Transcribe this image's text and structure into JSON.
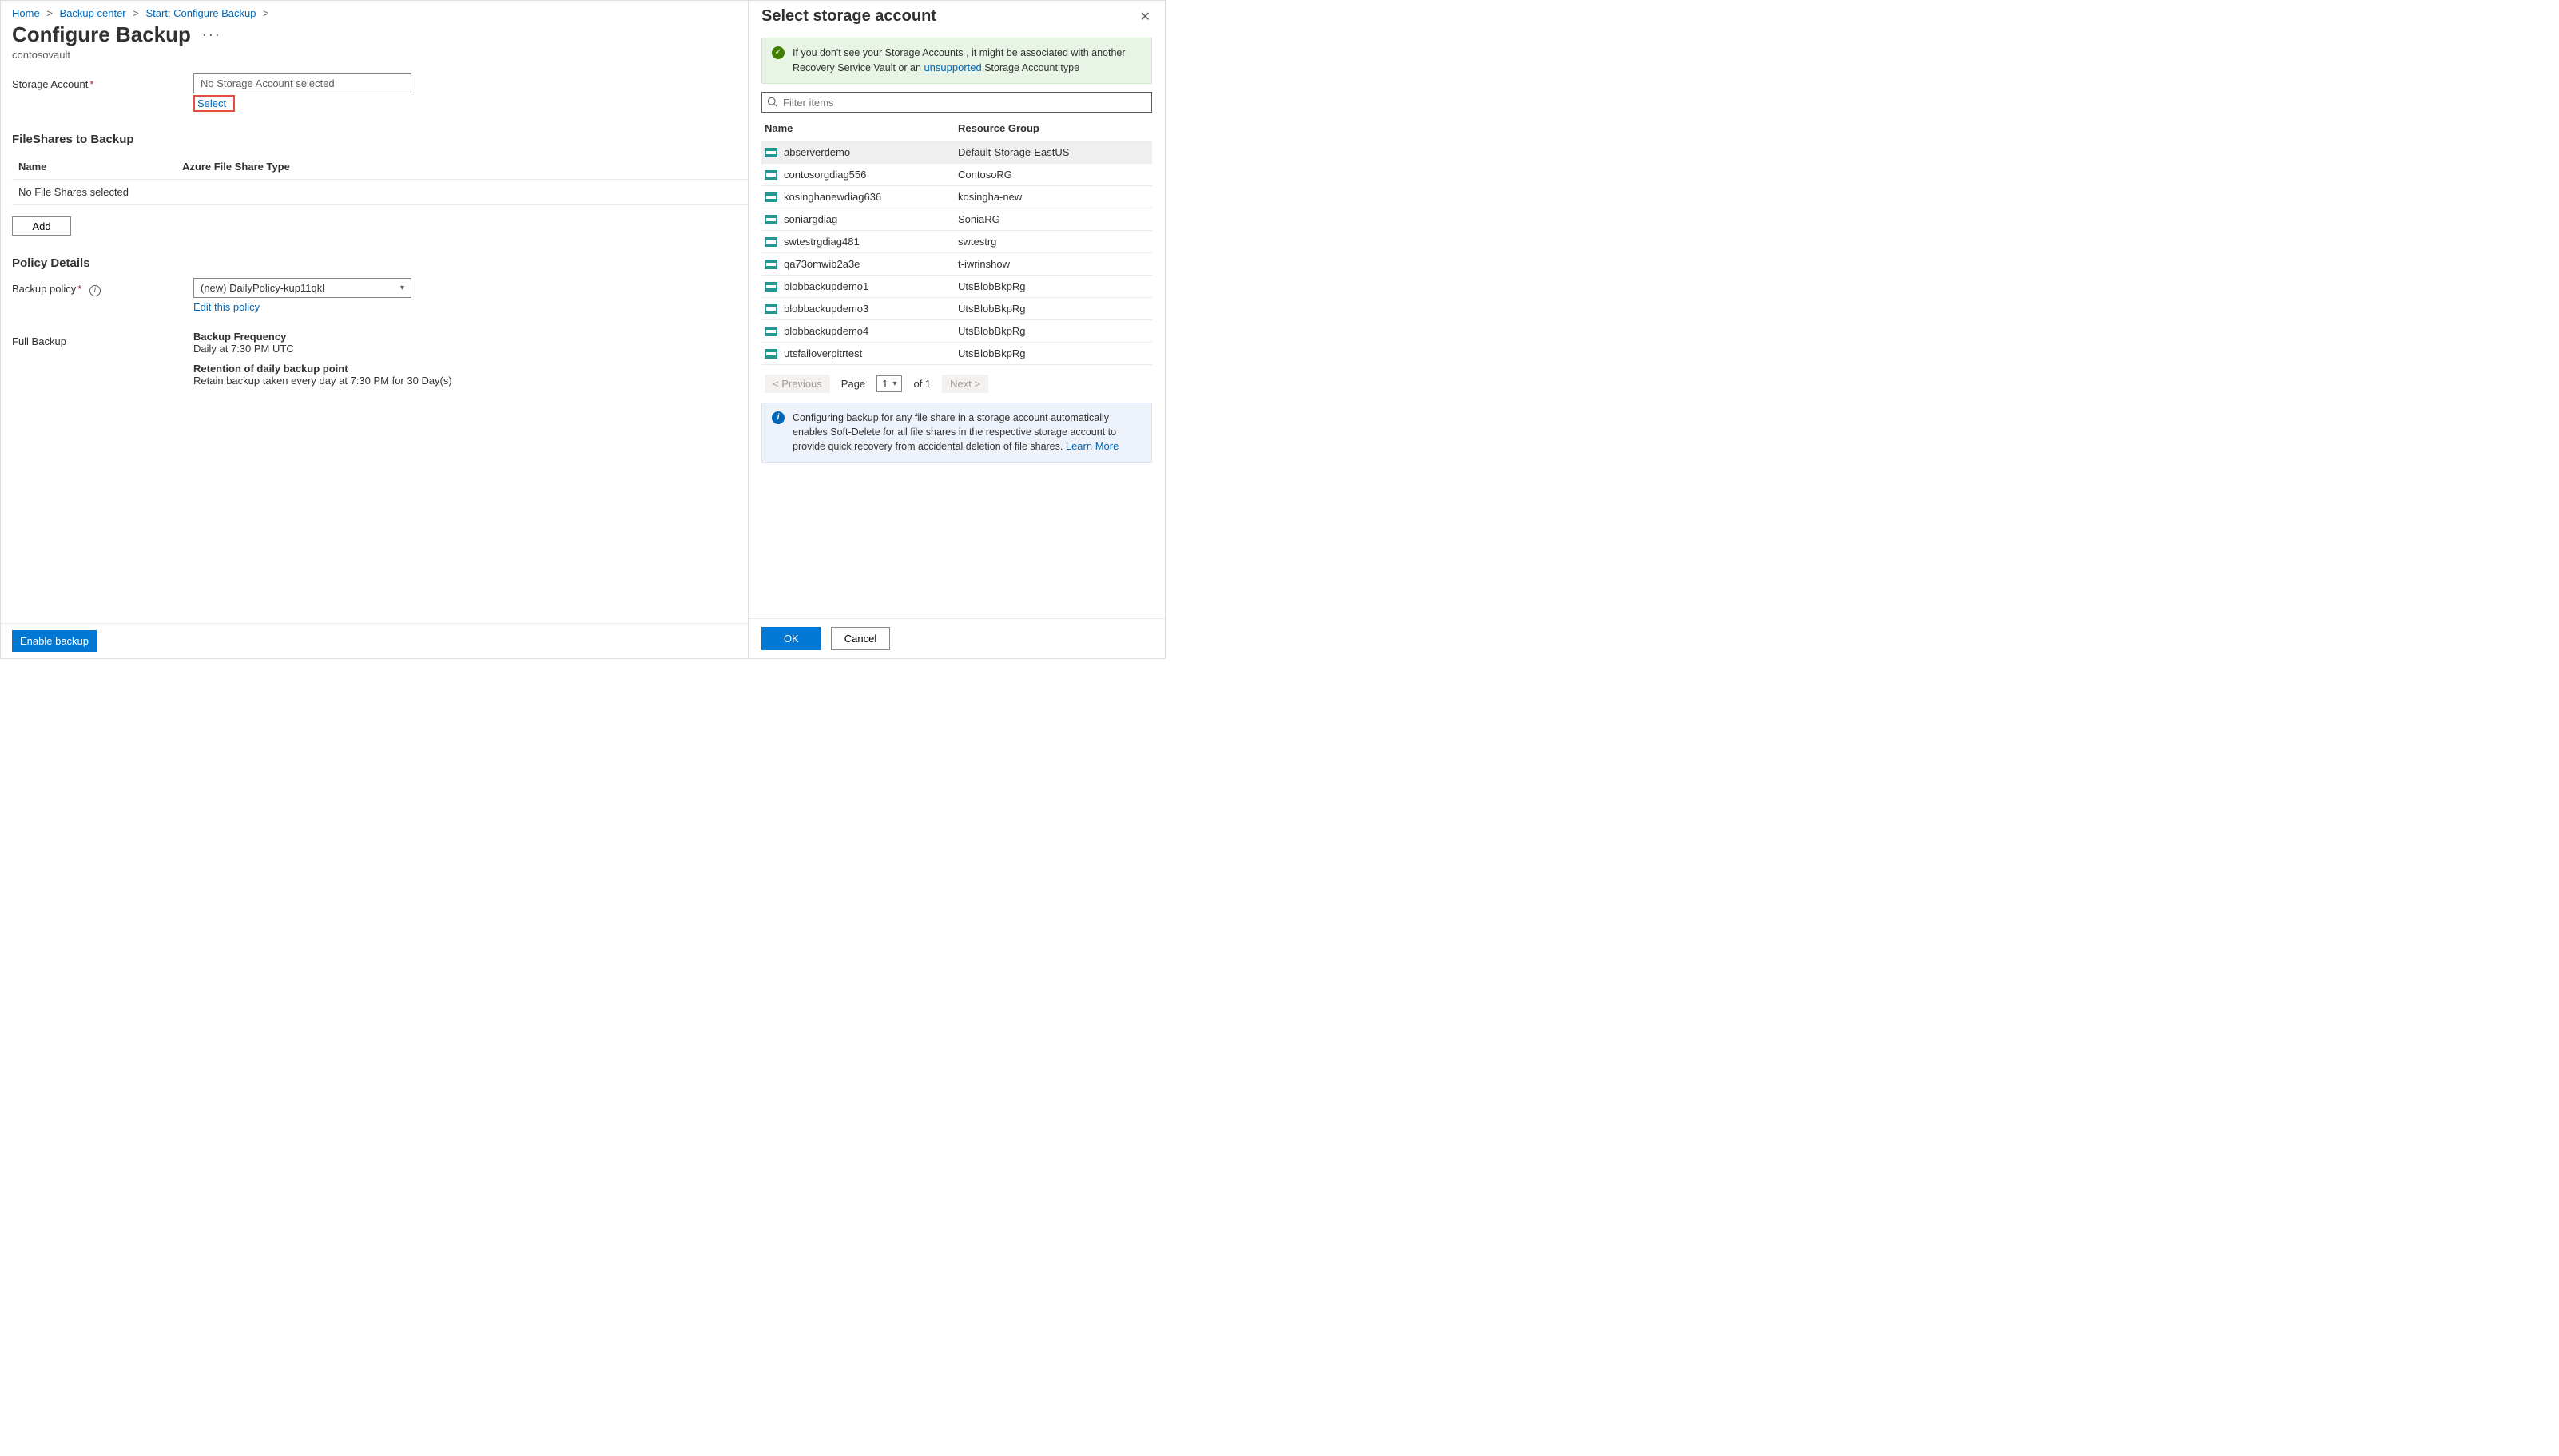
{
  "breadcrumb": {
    "items": [
      "Home",
      "Backup center",
      "Start: Configure Backup"
    ]
  },
  "page": {
    "title": "Configure Backup",
    "subtitle": "contosovault"
  },
  "form": {
    "storage_label": "Storage Account",
    "storage_value": "No Storage Account selected",
    "select_link": "Select",
    "fileshares_heading": "FileShares to Backup",
    "col_name": "Name",
    "col_type": "Azure File Share Type",
    "empty_row": "No File Shares selected",
    "add_btn": "Add",
    "policy_heading": "Policy Details",
    "backup_policy_label": "Backup policy",
    "policy_value": "(new) DailyPolicy-kup11qkl",
    "edit_policy": "Edit this policy",
    "full_backup_label": "Full Backup",
    "freq_h": "Backup Frequency",
    "freq_v": "Daily at 7:30 PM UTC",
    "ret_h": "Retention of daily backup point",
    "ret_v": "Retain backup taken every day at 7:30 PM for 30 Day(s)"
  },
  "footer": {
    "enable": "Enable backup"
  },
  "panel": {
    "title": "Select storage account",
    "notice_pre": "If you don't see your Storage Accounts , it might be associated with another Recovery Service Vault or an ",
    "notice_link": "unsupported",
    "notice_post": " Storage Account type",
    "search_placeholder": "Filter items",
    "col_name": "Name",
    "col_rg": "Resource Group",
    "rows": [
      {
        "name": "abserverdemo",
        "rg": "Default-Storage-EastUS",
        "selected": true
      },
      {
        "name": "contosorgdiag556",
        "rg": "ContosoRG"
      },
      {
        "name": "kosinghanewdiag636",
        "rg": "kosingha-new"
      },
      {
        "name": "soniargdiag",
        "rg": "SoniaRG"
      },
      {
        "name": "swtestrgdiag481",
        "rg": "swtestrg"
      },
      {
        "name": "qa73omwib2a3e",
        "rg": "t-iwrinshow"
      },
      {
        "name": "blobbackupdemo1",
        "rg": "UtsBlobBkpRg"
      },
      {
        "name": "blobbackupdemo3",
        "rg": "UtsBlobBkpRg"
      },
      {
        "name": "blobbackupdemo4",
        "rg": "UtsBlobBkpRg"
      },
      {
        "name": "utsfailoverpitrtest",
        "rg": "UtsBlobBkpRg"
      }
    ],
    "pager": {
      "prev": "< Previous",
      "page_lbl": "Page",
      "page": "1",
      "of": "of  1",
      "next": "Next >"
    },
    "info_text": "Configuring backup for any file share in a storage account automatically enables Soft-Delete for all file shares in the respective storage account to provide quick recovery from accidental deletion of file shares. ",
    "learn_more": "Learn More",
    "ok": "OK",
    "cancel": "Cancel"
  }
}
